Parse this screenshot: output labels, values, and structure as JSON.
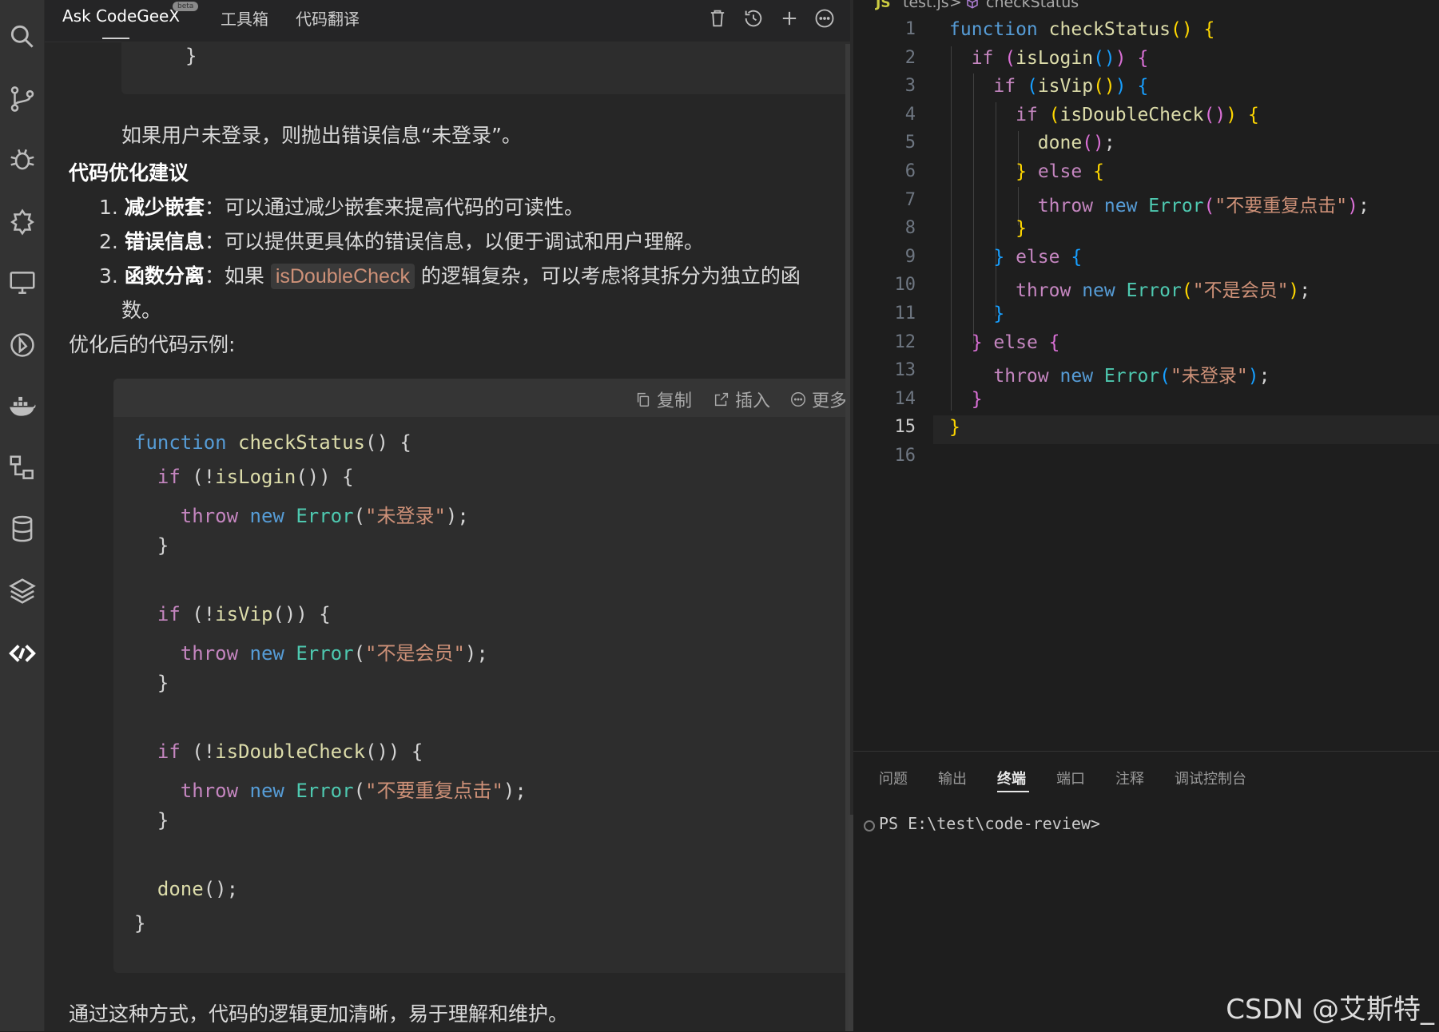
{
  "chat": {
    "tabs": [
      {
        "label": "Ask CodeGeeX",
        "active": true
      },
      {
        "label": "工具箱",
        "active": false
      },
      {
        "label": "代码翻译",
        "active": false
      }
    ],
    "beta_badge": "beta",
    "header_icons": [
      "trash-icon",
      "history-icon",
      "plus-icon",
      "more-icon"
    ],
    "prev_code_tail": "}",
    "paragraph_1": "如果用户未登录，则抛出错误信息“未登录”。",
    "section_title": "代码优化建议",
    "suggestions": [
      {
        "num": "1.",
        "title": "减少嵌套",
        "sep": "：",
        "text": "可以通过减少嵌套来提高代码的可读性。"
      },
      {
        "num": "2.",
        "title": "错误信息",
        "sep": "：",
        "text": "可以提供更具体的错误信息，以便于调试和用户理解。"
      },
      {
        "num": "3.",
        "title": "函数分离",
        "sep": "：",
        "text_before": "如果",
        "code": "isDoubleCheck",
        "text_after": "的逻辑复杂，可以考虑将其拆分为独立的函",
        "text_wrap": "数。"
      }
    ],
    "example_label": "优化后的代码示例:",
    "code_toolbar": {
      "copy": "复制",
      "insert": "插入",
      "more": "更多"
    },
    "closing_text": "通过这种方式，代码的逻辑更加清晰，易于理解和维护。"
  },
  "code_block_lines": [
    {
      "tokens": [
        [
          "kw",
          "function"
        ],
        [
          "pn",
          " "
        ],
        [
          "fn",
          "checkStatus"
        ],
        [
          "pn",
          "() {"
        ]
      ]
    },
    {
      "tokens": [
        [
          "pn",
          "  "
        ],
        [
          "ctl",
          "if"
        ],
        [
          "pn",
          " (!"
        ],
        [
          "fn",
          "isLogin"
        ],
        [
          "pn",
          "()) {"
        ]
      ]
    },
    {
      "tokens": [
        [
          "pn",
          "    "
        ],
        [
          "ctl",
          "throw"
        ],
        [
          "pn",
          " "
        ],
        [
          "kw",
          "new"
        ],
        [
          "pn",
          " "
        ],
        [
          "cls",
          "Error"
        ],
        [
          "pn",
          "("
        ],
        [
          "str",
          "\"未登录\""
        ],
        [
          "pn",
          ");"
        ]
      ]
    },
    {
      "tokens": [
        [
          "pn",
          "  }"
        ]
      ]
    },
    {
      "tokens": [
        [
          "pn",
          ""
        ]
      ]
    },
    {
      "tokens": [
        [
          "pn",
          "  "
        ],
        [
          "ctl",
          "if"
        ],
        [
          "pn",
          " (!"
        ],
        [
          "fn",
          "isVip"
        ],
        [
          "pn",
          "()) {"
        ]
      ]
    },
    {
      "tokens": [
        [
          "pn",
          "    "
        ],
        [
          "ctl",
          "throw"
        ],
        [
          "pn",
          " "
        ],
        [
          "kw",
          "new"
        ],
        [
          "pn",
          " "
        ],
        [
          "cls",
          "Error"
        ],
        [
          "pn",
          "("
        ],
        [
          "str",
          "\"不是会员\""
        ],
        [
          "pn",
          ");"
        ]
      ]
    },
    {
      "tokens": [
        [
          "pn",
          "  }"
        ]
      ]
    },
    {
      "tokens": [
        [
          "pn",
          ""
        ]
      ]
    },
    {
      "tokens": [
        [
          "pn",
          "  "
        ],
        [
          "ctl",
          "if"
        ],
        [
          "pn",
          " (!"
        ],
        [
          "fn",
          "isDoubleCheck"
        ],
        [
          "pn",
          "()) {"
        ]
      ]
    },
    {
      "tokens": [
        [
          "pn",
          "    "
        ],
        [
          "ctl",
          "throw"
        ],
        [
          "pn",
          " "
        ],
        [
          "kw",
          "new"
        ],
        [
          "pn",
          " "
        ],
        [
          "cls",
          "Error"
        ],
        [
          "pn",
          "("
        ],
        [
          "str",
          "\"不要重复点击\""
        ],
        [
          "pn",
          ");"
        ]
      ]
    },
    {
      "tokens": [
        [
          "pn",
          "  }"
        ]
      ]
    },
    {
      "tokens": [
        [
          "pn",
          ""
        ]
      ]
    },
    {
      "tokens": [
        [
          "pn",
          "  "
        ],
        [
          "fn",
          "done"
        ],
        [
          "pn",
          "();"
        ]
      ]
    },
    {
      "tokens": [
        [
          "pn",
          "}"
        ]
      ]
    }
  ],
  "editor": {
    "breadcrumb": {
      "file_icon": "JS",
      "file": "test.js",
      "separator": ">",
      "symbol": "checkStatus"
    },
    "current_line": 15,
    "lines": [
      {
        "n": "1",
        "tokens": [
          [
            "kw",
            "function"
          ],
          [
            "pn",
            " "
          ],
          [
            "fn",
            "checkStatus"
          ],
          [
            "br1",
            "()"
          ],
          [
            "pn",
            " "
          ],
          [
            "br1",
            "{"
          ]
        ]
      },
      {
        "n": "2",
        "tokens": [
          [
            "pn",
            "  "
          ],
          [
            "ctl",
            "if"
          ],
          [
            "pn",
            " "
          ],
          [
            "br2",
            "("
          ],
          [
            "fn",
            "isLogin"
          ],
          [
            "br3",
            "()"
          ],
          [
            "br2",
            ")"
          ],
          [
            "pn",
            " "
          ],
          [
            "br2",
            "{"
          ]
        ]
      },
      {
        "n": "3",
        "tokens": [
          [
            "pn",
            "    "
          ],
          [
            "ctl",
            "if"
          ],
          [
            "pn",
            " "
          ],
          [
            "br3",
            "("
          ],
          [
            "fn",
            "isVip"
          ],
          [
            "br1",
            "()"
          ],
          [
            "br3",
            ")"
          ],
          [
            "pn",
            " "
          ],
          [
            "br3",
            "{"
          ]
        ]
      },
      {
        "n": "4",
        "tokens": [
          [
            "pn",
            "      "
          ],
          [
            "ctl",
            "if"
          ],
          [
            "pn",
            " "
          ],
          [
            "br1",
            "("
          ],
          [
            "fn",
            "isDoubleCheck"
          ],
          [
            "br2",
            "()"
          ],
          [
            "br1",
            ")"
          ],
          [
            "pn",
            " "
          ],
          [
            "br1",
            "{"
          ]
        ]
      },
      {
        "n": "5",
        "tokens": [
          [
            "pn",
            "        "
          ],
          [
            "fn",
            "done"
          ],
          [
            "br2",
            "()"
          ],
          [
            "pn",
            ";"
          ]
        ]
      },
      {
        "n": "6",
        "tokens": [
          [
            "pn",
            "      "
          ],
          [
            "br1",
            "}"
          ],
          [
            "pn",
            " "
          ],
          [
            "ctl",
            "else"
          ],
          [
            "pn",
            " "
          ],
          [
            "br1",
            "{"
          ]
        ]
      },
      {
        "n": "7",
        "tokens": [
          [
            "pn",
            "        "
          ],
          [
            "ctl",
            "throw"
          ],
          [
            "pn",
            " "
          ],
          [
            "kw",
            "new"
          ],
          [
            "pn",
            " "
          ],
          [
            "cls",
            "Error"
          ],
          [
            "br2",
            "("
          ],
          [
            "str",
            "\"不要重复点击\""
          ],
          [
            "br2",
            ")"
          ],
          [
            "pn",
            ";"
          ]
        ]
      },
      {
        "n": "8",
        "tokens": [
          [
            "pn",
            "      "
          ],
          [
            "br1",
            "}"
          ]
        ]
      },
      {
        "n": "9",
        "tokens": [
          [
            "pn",
            "    "
          ],
          [
            "br3",
            "}"
          ],
          [
            "pn",
            " "
          ],
          [
            "ctl",
            "else"
          ],
          [
            "pn",
            " "
          ],
          [
            "br3",
            "{"
          ]
        ]
      },
      {
        "n": "10",
        "tokens": [
          [
            "pn",
            "      "
          ],
          [
            "ctl",
            "throw"
          ],
          [
            "pn",
            " "
          ],
          [
            "kw",
            "new"
          ],
          [
            "pn",
            " "
          ],
          [
            "cls",
            "Error"
          ],
          [
            "br1",
            "("
          ],
          [
            "str",
            "\"不是会员\""
          ],
          [
            "br1",
            ")"
          ],
          [
            "pn",
            ";"
          ]
        ]
      },
      {
        "n": "11",
        "tokens": [
          [
            "pn",
            "    "
          ],
          [
            "br3",
            "}"
          ]
        ]
      },
      {
        "n": "12",
        "tokens": [
          [
            "pn",
            "  "
          ],
          [
            "br2",
            "}"
          ],
          [
            "pn",
            " "
          ],
          [
            "ctl",
            "else"
          ],
          [
            "pn",
            " "
          ],
          [
            "br2",
            "{"
          ]
        ]
      },
      {
        "n": "13",
        "tokens": [
          [
            "pn",
            "    "
          ],
          [
            "ctl",
            "throw"
          ],
          [
            "pn",
            " "
          ],
          [
            "kw",
            "new"
          ],
          [
            "pn",
            " "
          ],
          [
            "cls",
            "Error"
          ],
          [
            "br3",
            "("
          ],
          [
            "str",
            "\"未登录\""
          ],
          [
            "br3",
            ")"
          ],
          [
            "pn",
            ";"
          ]
        ]
      },
      {
        "n": "14",
        "tokens": [
          [
            "pn",
            "  "
          ],
          [
            "br2",
            "}"
          ]
        ]
      },
      {
        "n": "15",
        "tokens": [
          [
            "br1",
            "}"
          ]
        ]
      },
      {
        "n": "16",
        "tokens": [
          [
            "pn",
            ""
          ]
        ]
      }
    ]
  },
  "panel": {
    "tabs": [
      {
        "label": "问题",
        "active": false
      },
      {
        "label": "输出",
        "active": false
      },
      {
        "label": "终端",
        "active": true
      },
      {
        "label": "端口",
        "active": false
      },
      {
        "label": "注释",
        "active": false
      },
      {
        "label": "调试控制台",
        "active": false
      }
    ],
    "terminal_prompt": "PS E:\\test\\code-review>"
  },
  "activity_icons": [
    "search-icon",
    "source-control-icon",
    "debug-icon",
    "extensions-icon",
    "remote-explorer-icon",
    "timeline-icon",
    "docker-icon",
    "hierarchy-icon",
    "database-icon",
    "layers-icon",
    "codegeex-icon"
  ],
  "watermark": "CSDN @艾斯特_"
}
